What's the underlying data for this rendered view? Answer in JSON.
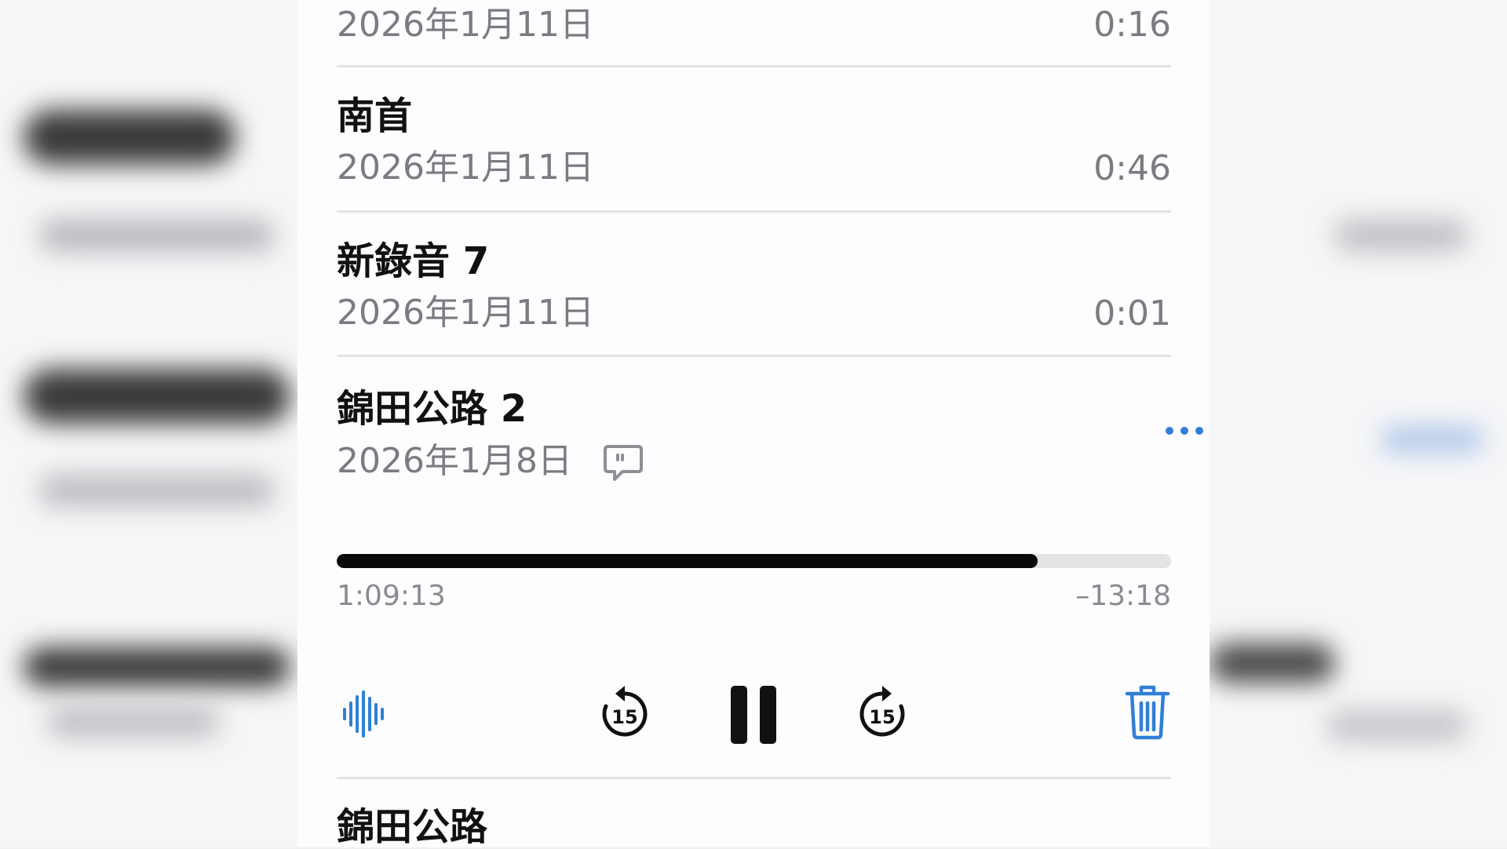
{
  "recordings": [
    {
      "date": "2026年1月11日",
      "duration": "0:16"
    },
    {
      "title": "南首",
      "date": "2026年1月11日",
      "duration": "0:46"
    },
    {
      "title": "新錄音 7",
      "date": "2026年1月11日",
      "duration": "0:01"
    }
  ],
  "active": {
    "title": "錦田公路 2",
    "date": "2026年1月8日",
    "elapsed": "1:09:13",
    "remaining": "–13:18",
    "progress_fraction": 0.84,
    "skip_seconds": "15"
  },
  "next": {
    "title": "錦田公路"
  },
  "colors": {
    "accent": "#2f7fd6",
    "text": "#111111",
    "secondary": "#7b7b80"
  },
  "icons": [
    "transcript-icon",
    "more-icon",
    "waveform-icon",
    "skip-back-15-icon",
    "pause-icon",
    "skip-forward-15-icon",
    "trash-icon"
  ]
}
